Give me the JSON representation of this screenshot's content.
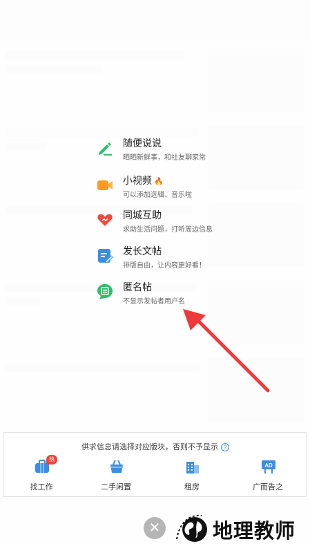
{
  "menu": {
    "items": [
      {
        "title": "随便说说",
        "subtitle": "晒晒新鲜事，和社友聊家常",
        "icon": "pencil-icon",
        "color": "#2ebd6b"
      },
      {
        "title": "小视频",
        "subtitle": "可以添加选辑、音乐啦",
        "icon": "video-camera-icon",
        "color": "#ff9a1f",
        "badge": "fire-icon"
      },
      {
        "title": "同城互助",
        "subtitle": "求助生活问题，打听周边信息",
        "icon": "heart-icon",
        "color": "#f04a3e"
      },
      {
        "title": "发长文帖",
        "subtitle": "排版自由，让内容更好看！",
        "icon": "edit-document-icon",
        "color": "#3a8ee6"
      },
      {
        "title": "匿名帖",
        "subtitle": "不显示发帖者用户名",
        "icon": "anonymous-icon",
        "color": "#2ebd6b"
      }
    ]
  },
  "panel": {
    "notice": "供求信息请选择对应版块，否则不予显示",
    "help_glyph": "?",
    "categories": [
      {
        "label": "找工作",
        "icon": "briefcase-icon",
        "badge": "热"
      },
      {
        "label": "二手闲置",
        "icon": "basket-icon"
      },
      {
        "label": "租房",
        "icon": "building-icon"
      },
      {
        "label": "广而告之",
        "icon": "ad-board-icon"
      }
    ]
  },
  "close_glyph": "✕",
  "watermark": {
    "text": "地理教师"
  },
  "colors": {
    "accent_red": "#f0433c",
    "link_blue": "#3a8ee6"
  }
}
